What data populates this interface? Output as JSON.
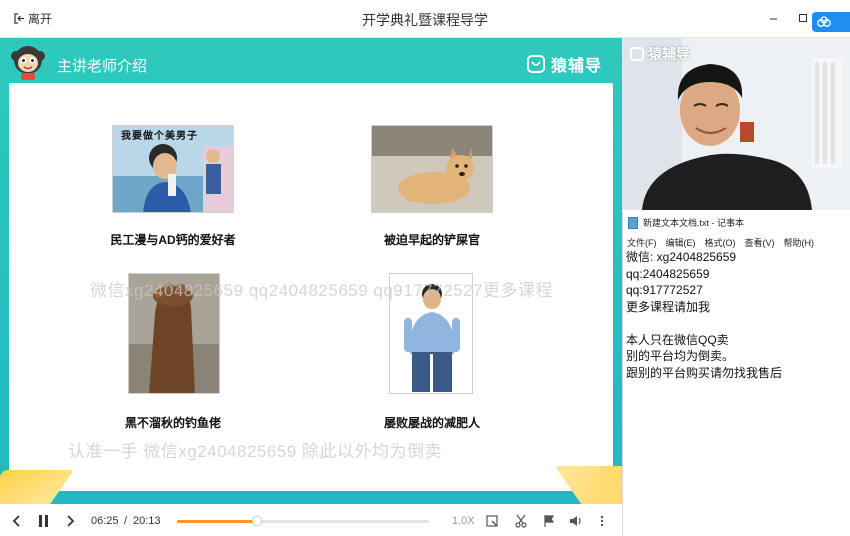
{
  "window": {
    "leave_label": "离开",
    "title": "开学典礼暨课程导学"
  },
  "slide": {
    "title": "主讲老师介绍",
    "brand": "猿辅导",
    "photo1_caption_text": "我要做个美男子",
    "items": [
      {
        "caption": "民工漫与AD钙的爱好者"
      },
      {
        "caption": "被迫早起的铲屎官"
      },
      {
        "caption": "黑不溜秋的钓鱼佬"
      },
      {
        "caption": "屡败屡战的减肥人"
      }
    ]
  },
  "watermarks": {
    "line1": "微信xg2404825659 qq2404825659 qq917772527更多课程",
    "line2": "认准一手  微信xg2404825659 除此以外均为倒卖"
  },
  "player": {
    "current_time": "06:25",
    "separator": "/",
    "total_time": "20:13",
    "progress": 0.317,
    "speed": "1.0X"
  },
  "camera": {
    "brand": "猿辅导"
  },
  "notepad": {
    "title": "新建文本文档.txt - 记事本",
    "menu": [
      "文件(F)",
      "编辑(E)",
      "格式(O)",
      "查看(V)",
      "帮助(H)"
    ],
    "lines": [
      "微信: xg2404825659",
      "qq:2404825659",
      "qq:917772527",
      "更多课程请加我",
      "",
      "本人只在微信QQ卖",
      "别的平台均为倒卖。",
      "跟别的平台购买请勿找我售后"
    ]
  },
  "colors": {
    "teal": "#2ec9bd",
    "progress": "#f39a34",
    "accent_blue": "#1e8ff0"
  }
}
